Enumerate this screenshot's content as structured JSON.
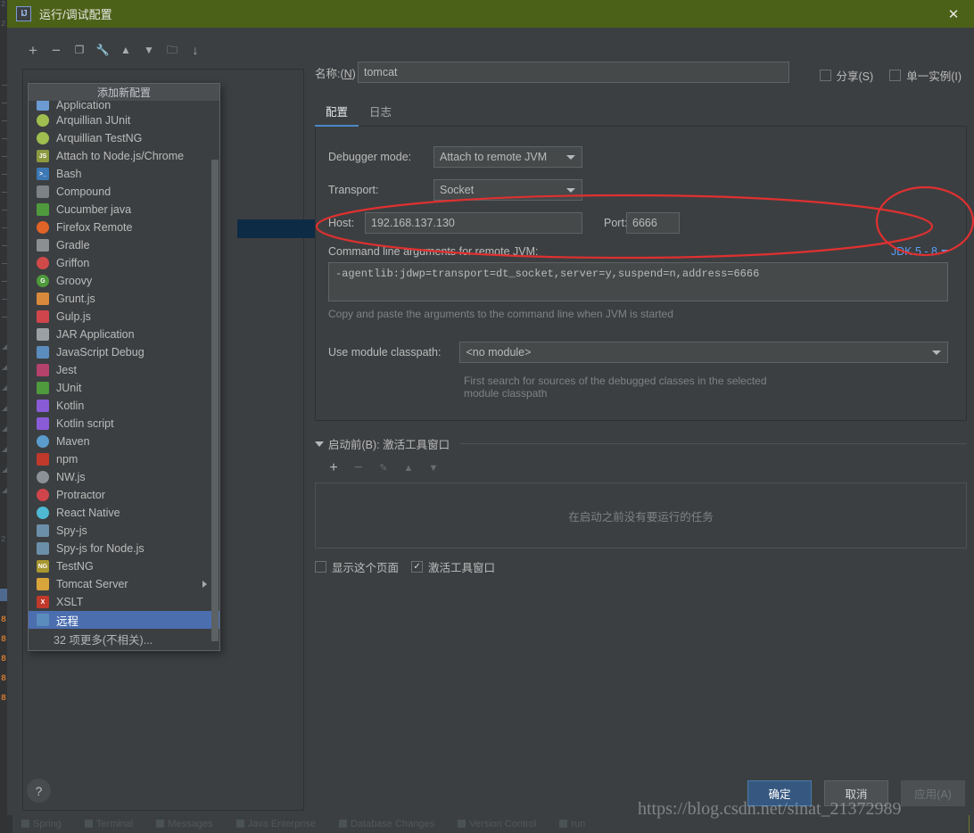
{
  "window": {
    "title": "运行/调试配置",
    "app_icon": "IJ",
    "close_icon": "✕"
  },
  "left_toolbar": {
    "buttons": [
      {
        "name": "add-configuration-button",
        "icon": "plus-icon",
        "glyph": "+"
      },
      {
        "name": "remove-configuration-button",
        "icon": "minus-icon",
        "glyph": "−"
      },
      {
        "name": "copy-configuration-button",
        "icon": "copy-icon",
        "glyph": "❐"
      },
      {
        "name": "edit-templates-button",
        "icon": "wrench-icon",
        "glyph": "🔧"
      },
      {
        "name": "move-up-button",
        "icon": "arrow-up-icon",
        "glyph": "▲"
      },
      {
        "name": "move-down-button",
        "icon": "arrow-down-icon",
        "glyph": "▼"
      },
      {
        "name": "create-folder-button",
        "icon": "folder-add-icon",
        "glyph": "🗀"
      },
      {
        "name": "sort-button",
        "icon": "sort-alpha-icon",
        "glyph": "↓"
      }
    ]
  },
  "popup": {
    "header": "添加新配置",
    "more_label": "32 项更多(不相关)...",
    "items": [
      {
        "label": "Application",
        "icon": "application-icon",
        "color": "#6b9bd2",
        "shape": "square",
        "text": "",
        "clipped": true
      },
      {
        "label": "Arquillian JUnit",
        "icon": "arquillian-icon",
        "color": "#9fbe4f",
        "shape": "circle",
        "text": ""
      },
      {
        "label": "Arquillian TestNG",
        "icon": "arquillian-icon",
        "color": "#9fbe4f",
        "shape": "circle",
        "text": ""
      },
      {
        "label": "Attach to Node.js/Chrome",
        "icon": "nodejs-attach-icon",
        "color": "#8d9a3f",
        "shape": "square",
        "text": "JS"
      },
      {
        "label": "Bash",
        "icon": "bash-terminal-icon",
        "color": "#3c78b4",
        "shape": "square",
        "text": ">_"
      },
      {
        "label": "Compound",
        "icon": "compound-folder-icon",
        "color": "#7d8287",
        "shape": "square",
        "text": ""
      },
      {
        "label": "Cucumber java",
        "icon": "cucumber-icon",
        "color": "#4e9a3d",
        "shape": "square",
        "text": ""
      },
      {
        "label": "Firefox Remote",
        "icon": "firefox-icon",
        "color": "#e06327",
        "shape": "circle",
        "text": ""
      },
      {
        "label": "Gradle",
        "icon": "gradle-elephant-icon",
        "color": "#8b8f92",
        "shape": "square",
        "text": ""
      },
      {
        "label": "Griffon",
        "icon": "griffon-icon",
        "color": "#d04a4a",
        "shape": "circle",
        "text": ""
      },
      {
        "label": "Groovy",
        "icon": "groovy-icon",
        "color": "#4e9a3d",
        "shape": "circle",
        "text": "G"
      },
      {
        "label": "Grunt.js",
        "icon": "grunt-icon",
        "color": "#d8893b",
        "shape": "square",
        "text": ""
      },
      {
        "label": "Gulp.js",
        "icon": "gulp-icon",
        "color": "#d0454c",
        "shape": "square",
        "text": ""
      },
      {
        "label": "JAR Application",
        "icon": "jar-icon",
        "color": "#9aa0a4",
        "shape": "square",
        "text": ""
      },
      {
        "label": "JavaScript Debug",
        "icon": "javascript-debug-icon",
        "color": "#5b8cbe",
        "shape": "square",
        "text": ""
      },
      {
        "label": "Jest",
        "icon": "jest-icon",
        "color": "#b4426b",
        "shape": "square",
        "text": ""
      },
      {
        "label": "JUnit",
        "icon": "junit-icon",
        "color": "#4e9a3d",
        "shape": "square",
        "text": ""
      },
      {
        "label": "Kotlin",
        "icon": "kotlin-icon",
        "color": "#8a5bd6",
        "shape": "square",
        "text": ""
      },
      {
        "label": "Kotlin script",
        "icon": "kotlin-icon",
        "color": "#8a5bd6",
        "shape": "square",
        "text": ""
      },
      {
        "label": "Maven",
        "icon": "maven-gear-icon",
        "color": "#5b9ccc",
        "shape": "circle",
        "text": ""
      },
      {
        "label": "npm",
        "icon": "npm-icon",
        "color": "#c0392b",
        "shape": "square",
        "text": ""
      },
      {
        "label": "NW.js",
        "icon": "nwjs-icon",
        "color": "#8b9196",
        "shape": "circle",
        "text": ""
      },
      {
        "label": "Protractor",
        "icon": "protractor-icon",
        "color": "#d0454c",
        "shape": "circle",
        "text": ""
      },
      {
        "label": "React Native",
        "icon": "react-native-icon",
        "color": "#4fb9d4",
        "shape": "circle",
        "text": ""
      },
      {
        "label": "Spy-js",
        "icon": "spy-js-icon",
        "color": "#6b8fa8",
        "shape": "square",
        "text": ""
      },
      {
        "label": "Spy-js for Node.js",
        "icon": "spy-js-node-icon",
        "color": "#6b8fa8",
        "shape": "square",
        "text": ""
      },
      {
        "label": "TestNG",
        "icon": "testng-icon",
        "color": "#a8962f",
        "shape": "square",
        "text": "NG"
      },
      {
        "label": "Tomcat Server",
        "icon": "tomcat-icon",
        "color": "#d8a53b",
        "shape": "square",
        "text": "",
        "submenu": true
      },
      {
        "label": "XSLT",
        "icon": "xslt-icon",
        "color": "#c0392b",
        "shape": "square",
        "text": "X"
      },
      {
        "label": "远程",
        "icon": "remote-icon",
        "color": "#5b8cbe",
        "shape": "square",
        "text": "",
        "selected": true
      }
    ]
  },
  "name_field": {
    "label": "名称:(N)",
    "label_underline": "N",
    "value": "tomcat",
    "placeholder": ""
  },
  "top_checkboxes": [
    {
      "label": "分享(S)",
      "checked": false,
      "name": "share-checkbox"
    },
    {
      "label": "单一实例(I)",
      "checked": false,
      "name": "single-instance-checkbox"
    }
  ],
  "tabs": [
    {
      "label": "配置",
      "active": true,
      "name": "tab-configuration"
    },
    {
      "label": "日志",
      "active": false,
      "name": "tab-logs"
    }
  ],
  "form": {
    "debugger_mode": {
      "label": "Debugger mode:",
      "value": "Attach to remote JVM"
    },
    "transport": {
      "label": "Transport:",
      "value": "Socket"
    },
    "host": {
      "label": "Host:",
      "value": "192.168.137.130"
    },
    "port": {
      "label": "Port:",
      "value": "6666"
    },
    "cmdline": {
      "label": "Command line arguments for remote JVM:",
      "value": "-agentlib:jdwp=transport=dt_socket,server=y,suspend=n,address=6666",
      "hint": "Copy and paste the arguments to the command line when JVM is started"
    },
    "jdk_selector": {
      "label": "JDK 5 - 8",
      "color": "#589df6"
    },
    "module_classpath": {
      "label": "Use module classpath:",
      "value": "<no module>",
      "hint_line1": "First search for sources of the debugged classes in the selected",
      "hint_line2": "module classpath"
    }
  },
  "before_launch": {
    "title": "启动前(B): 激活工具窗口",
    "toolbar": [
      {
        "name": "add-task-button",
        "glyph": "+",
        "enabled": true
      },
      {
        "name": "remove-task-button",
        "glyph": "−",
        "enabled": false
      },
      {
        "name": "edit-task-button",
        "glyph": "✎",
        "enabled": false
      },
      {
        "name": "move-task-up-button",
        "glyph": "▲",
        "enabled": false
      },
      {
        "name": "move-task-down-button",
        "glyph": "▼",
        "enabled": false
      }
    ],
    "empty_text": "在启动之前没有要运行的任务",
    "checkboxes": [
      {
        "label": "显示这个页面",
        "checked": false,
        "name": "show-this-page-checkbox"
      },
      {
        "label": "激活工具窗口",
        "checked": true,
        "name": "activate-tool-window-checkbox"
      }
    ]
  },
  "footer": {
    "help_icon": "?",
    "buttons": [
      {
        "label": "确定",
        "name": "ok-button",
        "style": "primary"
      },
      {
        "label": "取消",
        "name": "cancel-button",
        "style": "normal"
      },
      {
        "label": "应用(A)",
        "name": "apply-button",
        "style": "disabled"
      }
    ]
  },
  "watermark": "https://blog.csdn.net/sinat_21372989",
  "ide_background": {
    "status_tabs": [
      "Spring",
      "Terminal",
      "Messages",
      "Java Enterprise",
      "Database Changes",
      "Version Control",
      "run"
    ]
  },
  "annotations": {
    "ellipse_cmdline": "red-ellipse-around-command-line-arguments",
    "ellipse_jdk": "red-ellipse-around-jdk-selector",
    "color": "#e03030"
  }
}
